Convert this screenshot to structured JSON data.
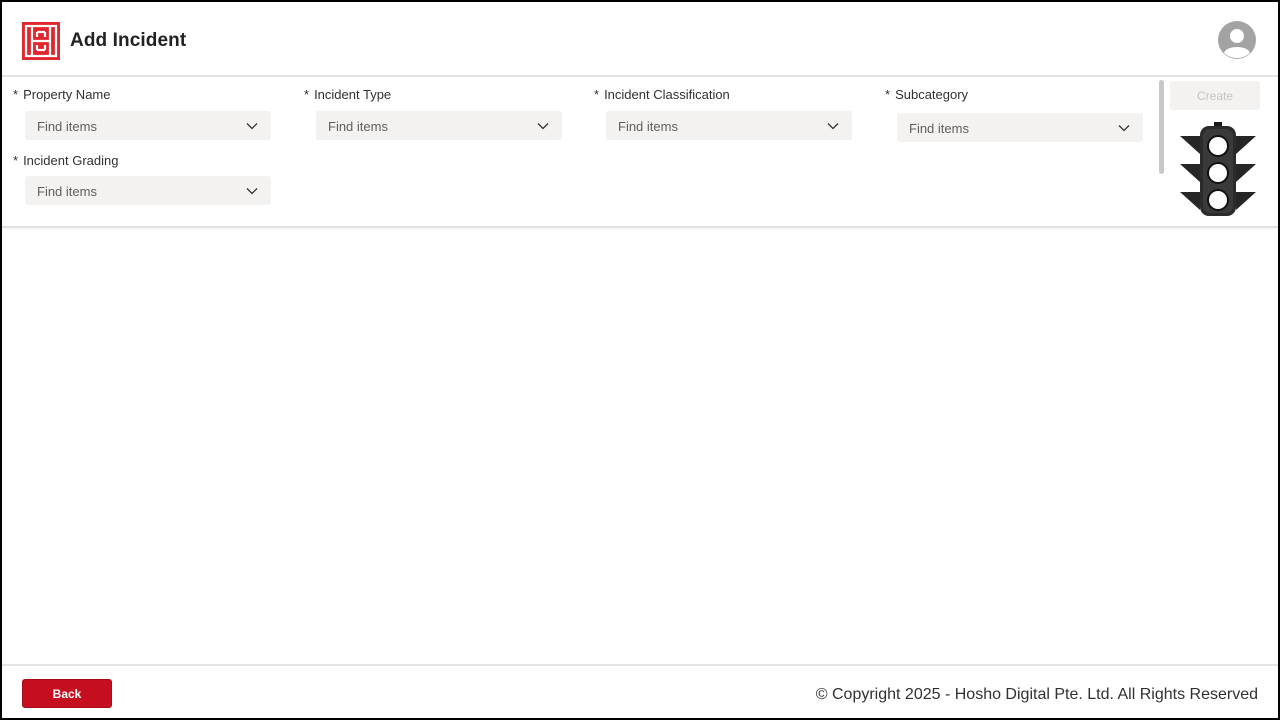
{
  "header": {
    "title": "Add Incident",
    "logo_icon": "hosho-logo-icon",
    "avatar_icon": "user-avatar-icon"
  },
  "form": {
    "fields": [
      {
        "label": "Property Name",
        "required_mark": "*",
        "placeholder": "Find items"
      },
      {
        "label": "Incident Type",
        "required_mark": "*",
        "placeholder": "Find items"
      },
      {
        "label": "Incident Classification",
        "required_mark": "*",
        "placeholder": "Find items"
      },
      {
        "label": "Subcategory",
        "required_mark": "*",
        "placeholder": "Find items"
      },
      {
        "label": "Incident Grading",
        "required_mark": "*",
        "placeholder": "Find items"
      }
    ],
    "create_label": "Create",
    "status_icon": "traffic-light-icon"
  },
  "footer": {
    "back_label": "Back",
    "copyright": "© Copyright 2025 - Hosho Digital Pte. Ltd. All Rights Reserved"
  },
  "colors": {
    "brand_red": "#c50f1f",
    "logo_red": "#e0262e",
    "field_bg": "#f3f2f1",
    "disabled_text": "#c4c4c4"
  }
}
